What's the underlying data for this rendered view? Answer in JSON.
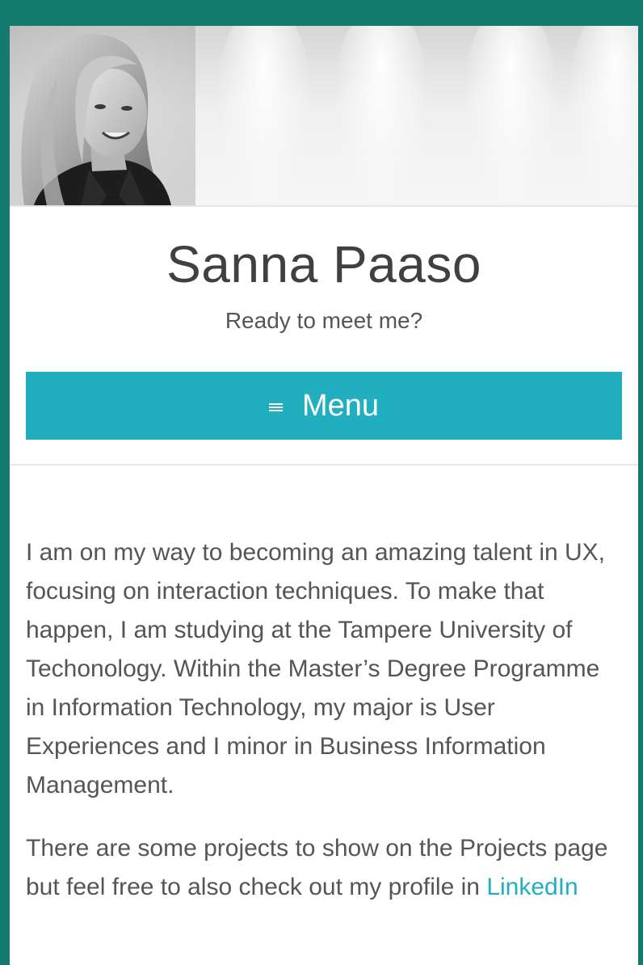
{
  "site": {
    "title": "Sanna Paaso",
    "tagline": "Ready to meet me?"
  },
  "nav": {
    "menu_label": "Menu",
    "menu_icon": "hamburger-icon"
  },
  "header": {
    "image": "profile-portrait-header"
  },
  "content": {
    "paragraph_1": "I am on my way to becoming an amazing talent in UX, focusing on interaction techniques. To make that happen, I am studying at the Tampere University of Techonology. Within the Master’s Degree Programme in Information Technology, my major is User Experiences and I minor in Business Information Management.",
    "paragraph_2_text": "There are some projects to show on the Projects page but feel free to also check out my profile in",
    "linkedin_label": "LinkedIn"
  },
  "colors": {
    "frame": "#137a70",
    "accent": "#21aebf",
    "text": "#555555",
    "title": "#404040"
  }
}
